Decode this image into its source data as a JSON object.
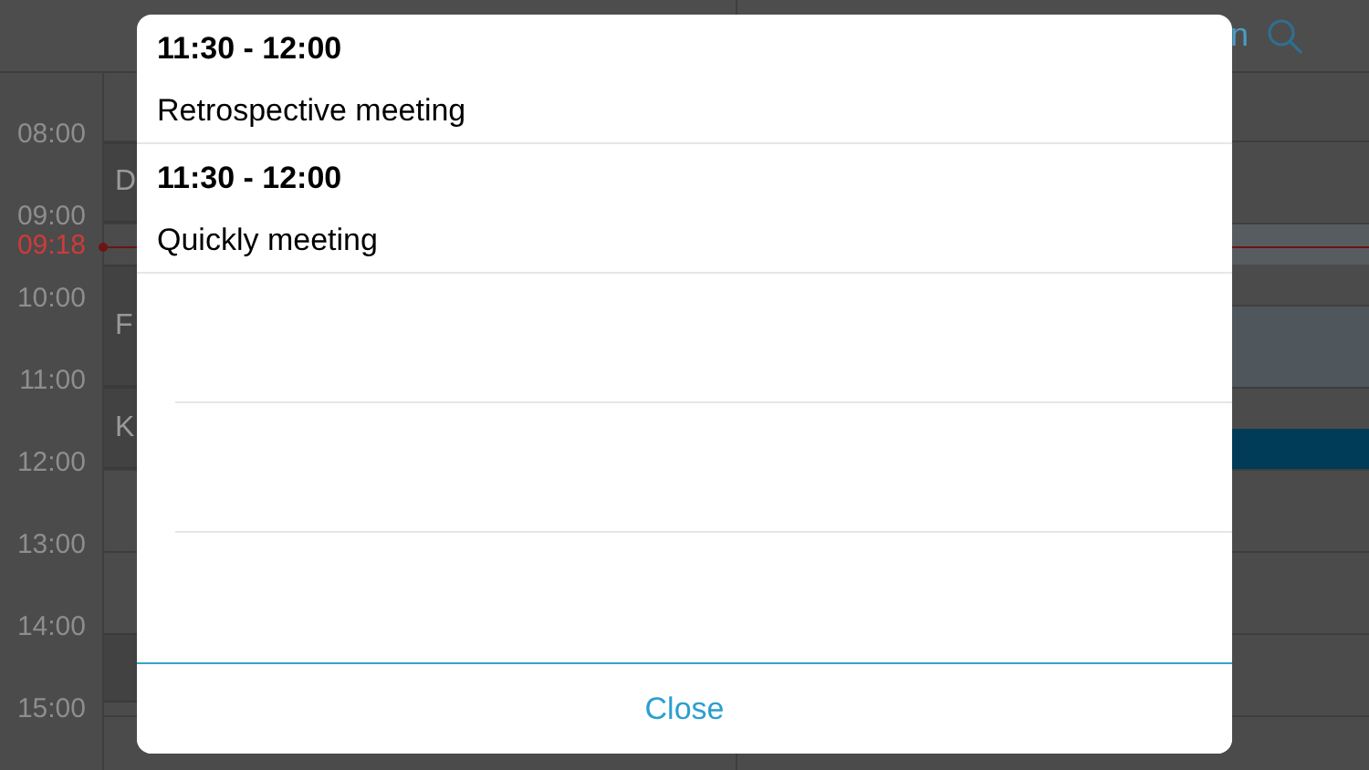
{
  "header": {
    "title_fragment": "n"
  },
  "time_labels": [
    "08:00",
    "09:00",
    "10:00",
    "11:00",
    "12:00",
    "13:00",
    "14:00",
    "15:00"
  ],
  "now_marker": {
    "time": "09:18"
  },
  "left_events": [
    {
      "title": "D",
      "kind": "event"
    },
    {
      "title": "F",
      "kind": "event"
    },
    {
      "title": "K",
      "kind": "event"
    },
    {
      "kind": "event"
    }
  ],
  "right_events": [
    {
      "kind": "light"
    },
    {
      "kind": "tinted"
    },
    {
      "kind": "selected"
    }
  ],
  "dialog": {
    "events": [
      {
        "time": "11:30 - 12:00",
        "title": "Retrospective meeting"
      },
      {
        "time": "11:30 - 12:00",
        "title": "Quickly meeting"
      }
    ],
    "close_button": "Close"
  }
}
